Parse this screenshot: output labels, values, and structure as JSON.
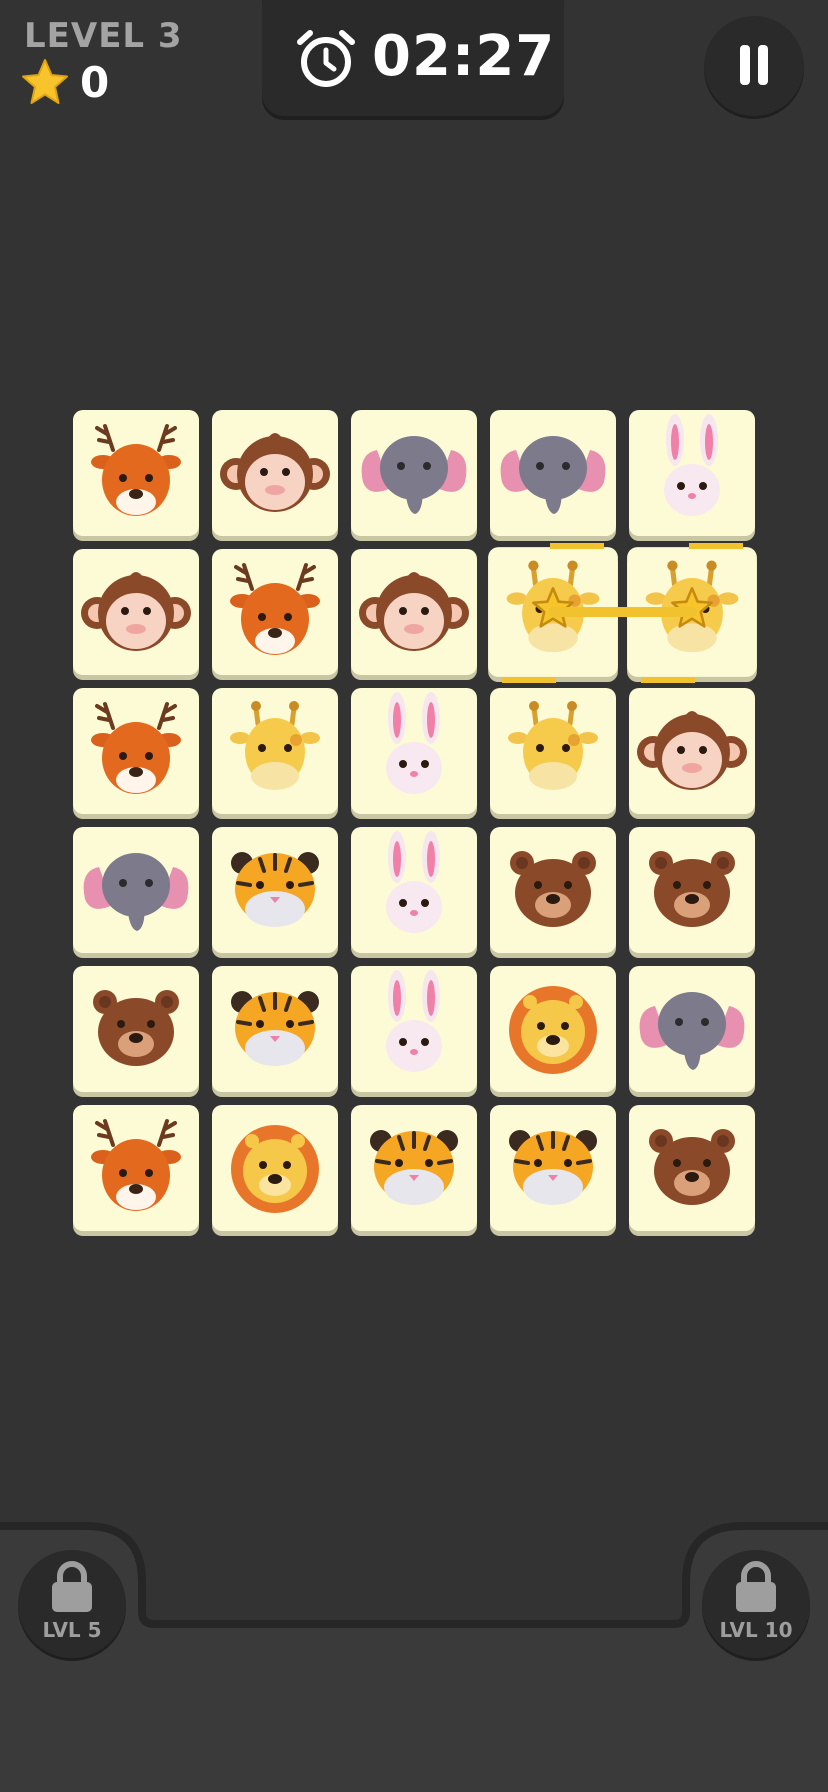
{
  "hud": {
    "level_label": "LEVEL 3",
    "score": "0",
    "timer": "02:27",
    "star_icon": "star-icon",
    "timer_icon": "stopwatch-icon",
    "pause_icon": "pause-icon"
  },
  "board": {
    "columns": 5,
    "rows": 6,
    "tiles": [
      "deer",
      "monkey",
      "elephant",
      "elephant",
      "rabbit",
      "monkey",
      "deer",
      "monkey",
      "giraffe",
      "giraffe",
      "deer",
      "giraffe",
      "rabbit",
      "giraffe",
      "monkey",
      "elephant",
      "tiger",
      "rabbit",
      "bear",
      "bear",
      "bear",
      "tiger",
      "rabbit",
      "lion",
      "elephant",
      "deer",
      "lion",
      "tiger",
      "tiger",
      "bear"
    ],
    "selected_tiles": [
      8,
      9
    ],
    "match_color": "#f2c12e"
  },
  "powerups": [
    {
      "label": "LVL 5",
      "icon": "lock-icon"
    },
    {
      "label": "LVL 10",
      "icon": "lock-icon"
    }
  ],
  "colors": {
    "background": "#333333",
    "tile": "#fdfbd6",
    "accent_yellow": "#f2c12e"
  }
}
